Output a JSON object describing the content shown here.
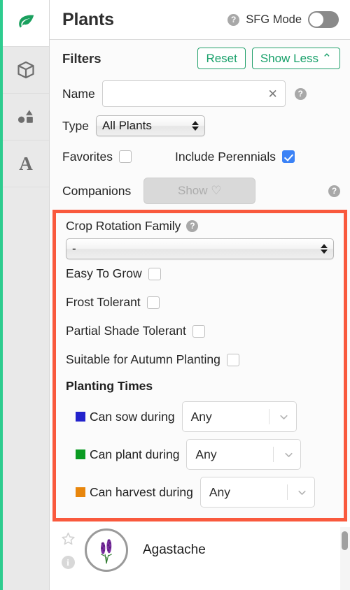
{
  "sidebar": {
    "items": [
      {
        "name": "leaf-icon",
        "label": "Plants",
        "active": true
      },
      {
        "name": "box-icon",
        "label": "Garden",
        "active": false
      },
      {
        "name": "shapes-icon",
        "label": "Shapes",
        "active": false
      },
      {
        "name": "text-icon",
        "label": "A",
        "active": false
      }
    ],
    "letter_item_label": "A"
  },
  "header": {
    "title": "Plants",
    "help_glyph": "?",
    "sfg_label": "SFG Mode",
    "sfg_enabled": false
  },
  "filters": {
    "title": "Filters",
    "reset_label": "Reset",
    "show_less_label": "Show Less ⌃",
    "name": {
      "label": "Name",
      "value": "",
      "placeholder": "",
      "clear_glyph": "✕",
      "help_glyph": "?"
    },
    "type": {
      "label": "Type",
      "value": "All Plants"
    },
    "favorites": {
      "label": "Favorites",
      "checked": false
    },
    "include_perennials": {
      "label": "Include Perennials",
      "checked": true
    },
    "companions": {
      "label": "Companions",
      "button_label": "Show ♡",
      "disabled": true,
      "help_glyph": "?"
    }
  },
  "advanced": {
    "crop_rotation_family": {
      "label": "Crop Rotation Family",
      "help_glyph": "?",
      "value": "-"
    },
    "checkboxes": [
      {
        "label": "Easy To Grow",
        "checked": false
      },
      {
        "label": "Frost Tolerant",
        "checked": false
      },
      {
        "label": "Partial Shade Tolerant",
        "checked": false
      },
      {
        "label": "Suitable for Autumn Planting",
        "checked": false
      }
    ],
    "planting_times": {
      "heading": "Planting Times",
      "rows": [
        {
          "label": "Can sow during",
          "value": "Any",
          "color": "#2222cc"
        },
        {
          "label": "Can plant during",
          "value": "Any",
          "color": "#0a9b22"
        },
        {
          "label": "Can harvest during",
          "value": "Any",
          "color": "#e8860c"
        }
      ]
    },
    "highlight_color": "#f9593d"
  },
  "results": {
    "rows": [
      {
        "name": "Agastache",
        "favorite": false,
        "star_glyph": "☆",
        "info_glyph": "i"
      }
    ]
  }
}
